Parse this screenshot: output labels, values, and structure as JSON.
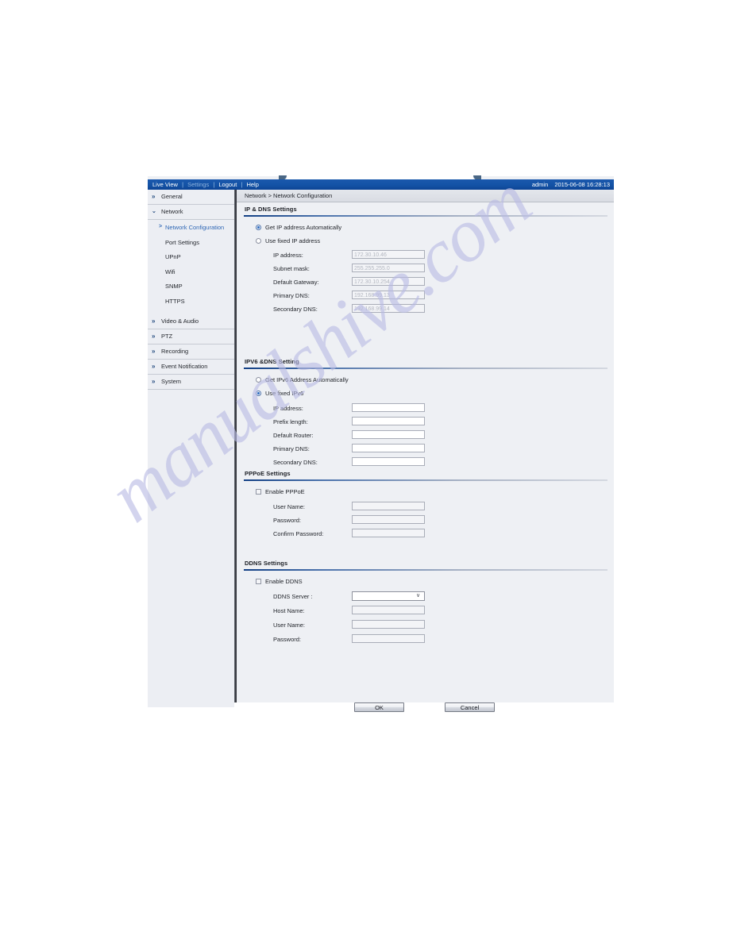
{
  "watermark": {
    "text": "manualshive.com"
  },
  "topbar": {
    "nav": [
      {
        "label": "Live View",
        "active": false
      },
      {
        "label": "Settings",
        "active": true
      },
      {
        "label": "Logout",
        "active": false
      },
      {
        "label": "Help",
        "active": false
      }
    ],
    "separator": "|",
    "user": "admin",
    "datetime": "2015-06-08 16:28:13"
  },
  "breadcrumb": {
    "text": "Network > Network Configuration"
  },
  "sidebar": {
    "groups": [
      {
        "label": "General",
        "icon": "chevron-right-double-icon",
        "expanded": false
      },
      {
        "label": "Network",
        "icon": "chevron-down-double-icon",
        "expanded": true,
        "items": [
          {
            "label": "Network Configuration",
            "selected": true
          },
          {
            "label": "Port Settings",
            "selected": false
          },
          {
            "label": "UPnP",
            "selected": false
          },
          {
            "label": "Wifi",
            "selected": false
          },
          {
            "label": "SNMP",
            "selected": false
          },
          {
            "label": "HTTPS",
            "selected": false
          }
        ]
      },
      {
        "label": "Video & Audio",
        "icon": "chevron-right-double-icon",
        "expanded": false
      },
      {
        "label": "PTZ",
        "icon": "chevron-right-double-icon",
        "expanded": false
      },
      {
        "label": "Recording",
        "icon": "chevron-right-double-icon",
        "expanded": false
      },
      {
        "label": "Event Notification",
        "icon": "chevron-right-double-icon",
        "expanded": false
      },
      {
        "label": "System",
        "icon": "chevron-right-double-icon",
        "expanded": false
      }
    ]
  },
  "sections": {
    "ipdns": {
      "title": "IP & DNS Settings",
      "radio_auto": "Get IP address Automatically",
      "radio_fixed": "Use fixed IP address",
      "fields": [
        {
          "label": "IP address:",
          "value": "172.30.10.46"
        },
        {
          "label": "Subnet mask:",
          "value": "255.255.255.0"
        },
        {
          "label": "Default Gateway:",
          "value": "172.30.10.254"
        },
        {
          "label": "Primary DNS:",
          "value": "192.168.99.13"
        },
        {
          "label": "Secondary DNS:",
          "value": "192.168.99.14"
        }
      ]
    },
    "ipv6": {
      "title": "IPV6 &DNS Setting",
      "radio_auto": "Get IPv6 Address Automatically",
      "radio_fixed": "Use fixed IPv6",
      "fields": [
        {
          "label": "IP address:",
          "value": ""
        },
        {
          "label": "Prefix length:",
          "value": ""
        },
        {
          "label": "Default Router:",
          "value": ""
        },
        {
          "label": "Primary DNS:",
          "value": ""
        },
        {
          "label": "Secondary DNS:",
          "value": ""
        }
      ]
    },
    "pppoe": {
      "title": "PPPoE Settings",
      "enable_label": "Enable PPPoE",
      "fields": [
        {
          "label": "User Name:",
          "value": ""
        },
        {
          "label": "Password:",
          "value": ""
        },
        {
          "label": "Confirm Password:",
          "value": ""
        }
      ]
    },
    "ddns": {
      "title": "DDNS Settings",
      "enable_label": "Enable DDNS",
      "server_label": "DDNS Server :",
      "server_value": "",
      "fields": [
        {
          "label": "Host Name:",
          "value": ""
        },
        {
          "label": "User Name:",
          "value": ""
        },
        {
          "label": "Password:",
          "value": ""
        }
      ]
    }
  },
  "footer": {
    "ok_label": "OK",
    "cancel_label": "Cancel"
  }
}
